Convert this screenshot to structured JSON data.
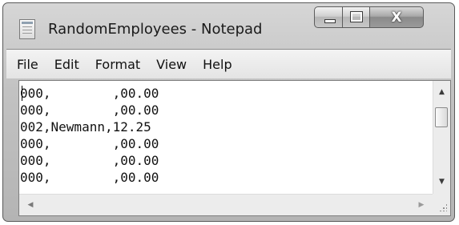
{
  "window": {
    "title": "RandomEmployees - Notepad",
    "icon": "notepad-icon"
  },
  "caption_buttons": {
    "minimize_icon": "minimize-icon",
    "maximize_icon": "maximize-icon",
    "close_label": "X"
  },
  "menu": {
    "items": [
      "File",
      "Edit",
      "Format",
      "View",
      "Help"
    ]
  },
  "editor": {
    "lines": [
      "000,        ,00.00",
      "000,        ,00.00",
      "002,Newmann,12.25",
      "000,        ,00.00",
      "000,        ,00.00",
      "000,        ,00.00"
    ]
  },
  "colors": {
    "titlebar": "#c2c2c2",
    "menubar": "#ececec",
    "editor_background": "#ffffff"
  }
}
